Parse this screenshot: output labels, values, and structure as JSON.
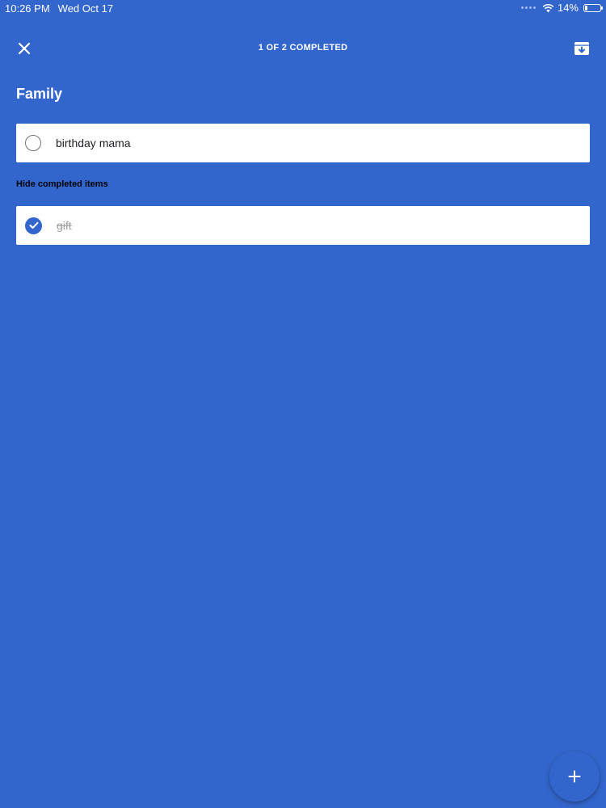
{
  "status_bar": {
    "time": "10:26 PM",
    "date": "Wed Oct 17",
    "battery_text": "14%",
    "battery_level": 0.14,
    "icons": [
      "cellular-dots-icon",
      "wifi-icon",
      "battery-icon"
    ]
  },
  "header": {
    "close_icon": "close-icon",
    "progress_text": "1 OF 2 COMPLETED",
    "archive_icon": "archive-icon"
  },
  "list": {
    "title": "Family",
    "items": [
      {
        "text": "birthday mama",
        "completed": false
      }
    ],
    "hide_completed_label": "Hide completed items",
    "completed_items": [
      {
        "text": "gift",
        "completed": true
      }
    ]
  },
  "fab": {
    "icon": "plus-icon"
  },
  "colors": {
    "background": "#3366cc",
    "card": "#ffffff",
    "text": "#202124",
    "completed_text": "#9e9e9e"
  }
}
